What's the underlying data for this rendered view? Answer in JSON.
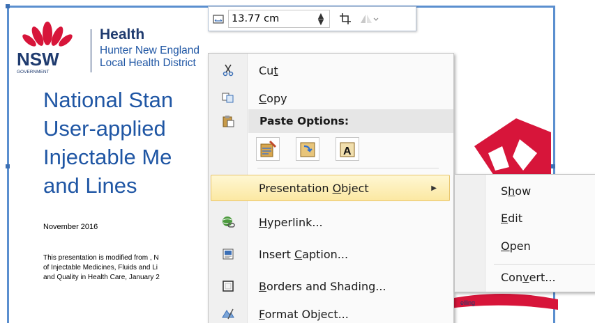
{
  "document": {
    "brand": {
      "word_nsw": "NSW",
      "word_government": "GOVERNMENT",
      "health": "Health",
      "line1": "Hunter New England",
      "line2": "Local Health District"
    },
    "title_lines": [
      "National Stan",
      "User-applied",
      "Injectable Me",
      "and Lines"
    ],
    "date": "November 2016",
    "paragraph_lines": [
      "This presentation is modified from , N",
      "of Injectable Medicines, Fluids and Li",
      "and Quality in Health Care, January 2"
    ],
    "footer_fragment": "elling"
  },
  "mini_toolbar": {
    "width_value": "13.77 cm",
    "icons": [
      "size-icon",
      "spin-icon",
      "crop-icon",
      "rotate-icon"
    ]
  },
  "context_menu": {
    "cut": {
      "pre": "Cu",
      "key": "t",
      "post": ""
    },
    "copy": {
      "pre": "",
      "key": "C",
      "post": "opy"
    },
    "paste_header": "Paste Options:",
    "paste_buttons": [
      "paste-keep-formatting-icon",
      "paste-link-icon",
      "paste-text-only-icon"
    ],
    "presentation_object": {
      "pre": "Presentation ",
      "key": "O",
      "post": "bject"
    },
    "hyperlink": {
      "pre": "",
      "key": "H",
      "post": "yperlink..."
    },
    "insert_caption": {
      "pre": "Insert ",
      "key": "C",
      "post": "aption..."
    },
    "borders": {
      "pre": "",
      "key": "B",
      "post": "orders and Shading..."
    },
    "format_object": {
      "pre": "",
      "key": "F",
      "post": "ormat Object..."
    }
  },
  "submenu": {
    "show": {
      "pre": "S",
      "key": "h",
      "post": "ow"
    },
    "edit": {
      "pre": "",
      "key": "E",
      "post": "dit"
    },
    "open": {
      "pre": "",
      "key": "O",
      "post": "pen"
    },
    "convert": {
      "pre": "Con",
      "key": "v",
      "post": "ert..."
    }
  },
  "colors": {
    "selection_border": "#5b8fcf",
    "title_blue": "#1f56a4",
    "hover_gold": "#fce8a2",
    "nsw_red": "#d7153a"
  }
}
